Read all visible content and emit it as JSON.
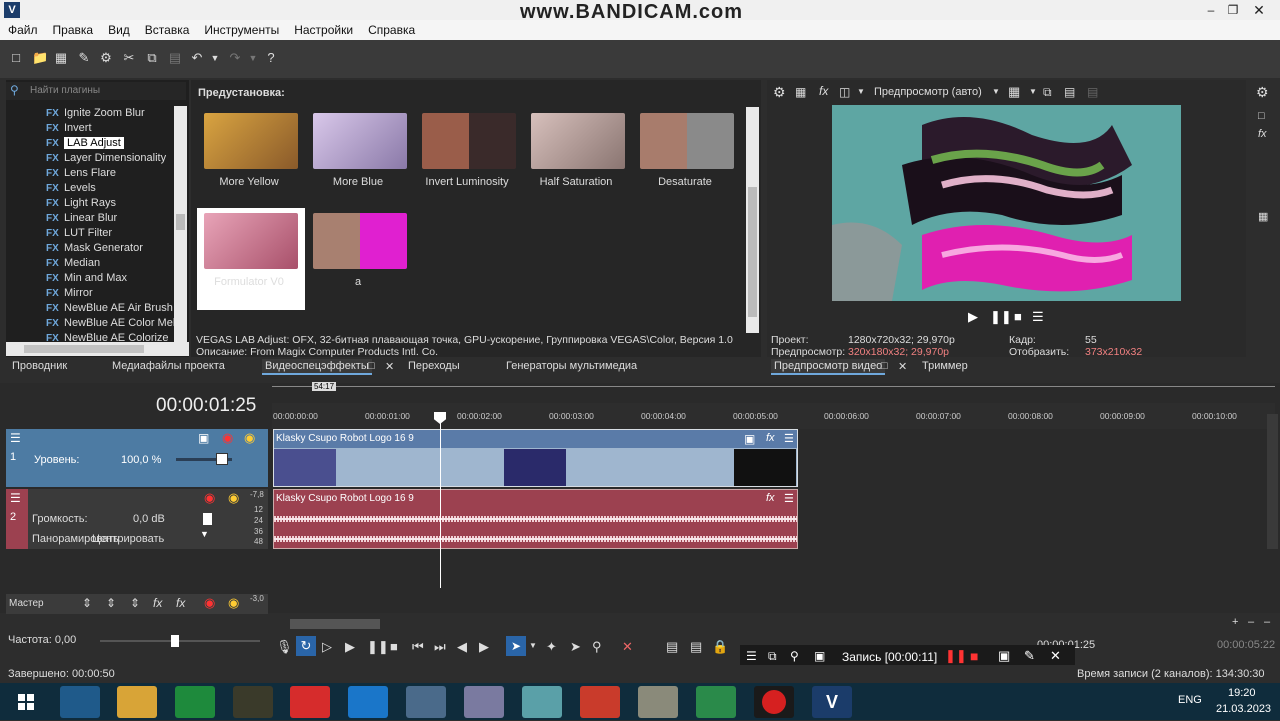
{
  "window": {
    "icon_letter": "V",
    "watermark": "www.BANDICAM.com"
  },
  "menu": [
    "Файл",
    "Правка",
    "Вид",
    "Вставка",
    "Инструменты",
    "Настройки",
    "Справка"
  ],
  "plugin_browser": {
    "search_placeholder": "Найти плагины",
    "items": [
      "Ignite Zoom Blur",
      "Invert",
      "LAB Adjust",
      "Layer Dimensionality",
      "Lens Flare",
      "Levels",
      "Light Rays",
      "Linear Blur",
      "LUT Filter",
      "Mask Generator",
      "Median",
      "Min and Max",
      "Mirror",
      "NewBlue AE Air Brush",
      "NewBlue AE Color Melt",
      "NewBlue AE Colorize"
    ],
    "selected": "LAB Adjust"
  },
  "presets": {
    "title": "Предустановка:",
    "items": [
      "More Yellow",
      "More Blue",
      "Invert Luminosity",
      "Half Saturation",
      "Desaturate",
      "Formulator V0",
      "a"
    ],
    "info_line1": "VEGAS LAB Adjust: OFX, 32-битная плавающая точка, GPU-ускорение, Группировка VEGAS\\Color, Версия 1.0",
    "info_line2": "Описание: From Magix Computer Products Intl. Co."
  },
  "preview": {
    "mode": "Предпросмотр (авто)",
    "project_label": "Проект:",
    "project_value": "1280x720x32; 29,970p",
    "preview_label": "Предпросмотр:",
    "preview_value": "320x180x32; 29,970p",
    "frame_label": "Кадр:",
    "frame_value": "55",
    "display_label": "Отобразить:",
    "display_value": "373x210x32"
  },
  "tabs": {
    "left": [
      "Проводник",
      "Медиафайлы проекта",
      "Видеоспецэффекты",
      "Переходы",
      "Генераторы мультимедиа"
    ],
    "right": [
      "Предпросмотр видео",
      "Триммер"
    ]
  },
  "timeline": {
    "timecode": "00:00:01:25",
    "loop_marker": "54:17",
    "ticks": [
      "00:00:00:00",
      "00:00:01:00",
      "00:00:02:00",
      "00:00:03:00",
      "00:00:04:00",
      "00:00:05:00",
      "00:00:06:00",
      "00:00:07:00",
      "00:00:08:00",
      "00:00:09:00",
      "00:00:10:00"
    ],
    "video_track": {
      "number": "1",
      "level_label": "Уровень:",
      "level_value": "100,0 %",
      "clip_name": "Klasky Csupo Robot Logo 16 9"
    },
    "audio_track": {
      "number": "2",
      "volume_label": "Громкость:",
      "volume_value": "0,0 dB",
      "pan_label": "Панорамировать",
      "pan_value": "Центрировать",
      "clip_name": "Klasky Csupo Robot Logo 16 9",
      "db_marks": [
        "-7,8",
        "12",
        "24",
        "36",
        "48"
      ]
    },
    "master_label": "Мастер",
    "master_db": "-3,0",
    "rate_label": "Частота: 0,00",
    "end_time": "00:00:01:25",
    "end_time2": "00:00:05:22"
  },
  "status": {
    "left": "Завершено: 00:00:50",
    "right": "Время записи (2 каналов): 134:30:30"
  },
  "recorder": {
    "label": "Запись [00:00:11]"
  },
  "taskbar": {
    "lang": "ENG",
    "time": "19:20",
    "date": "21.03.2023"
  },
  "colors": {
    "accent": "#4d7ba3",
    "audio": "#9c4150",
    "preview_bg": "#5ea6a3"
  }
}
